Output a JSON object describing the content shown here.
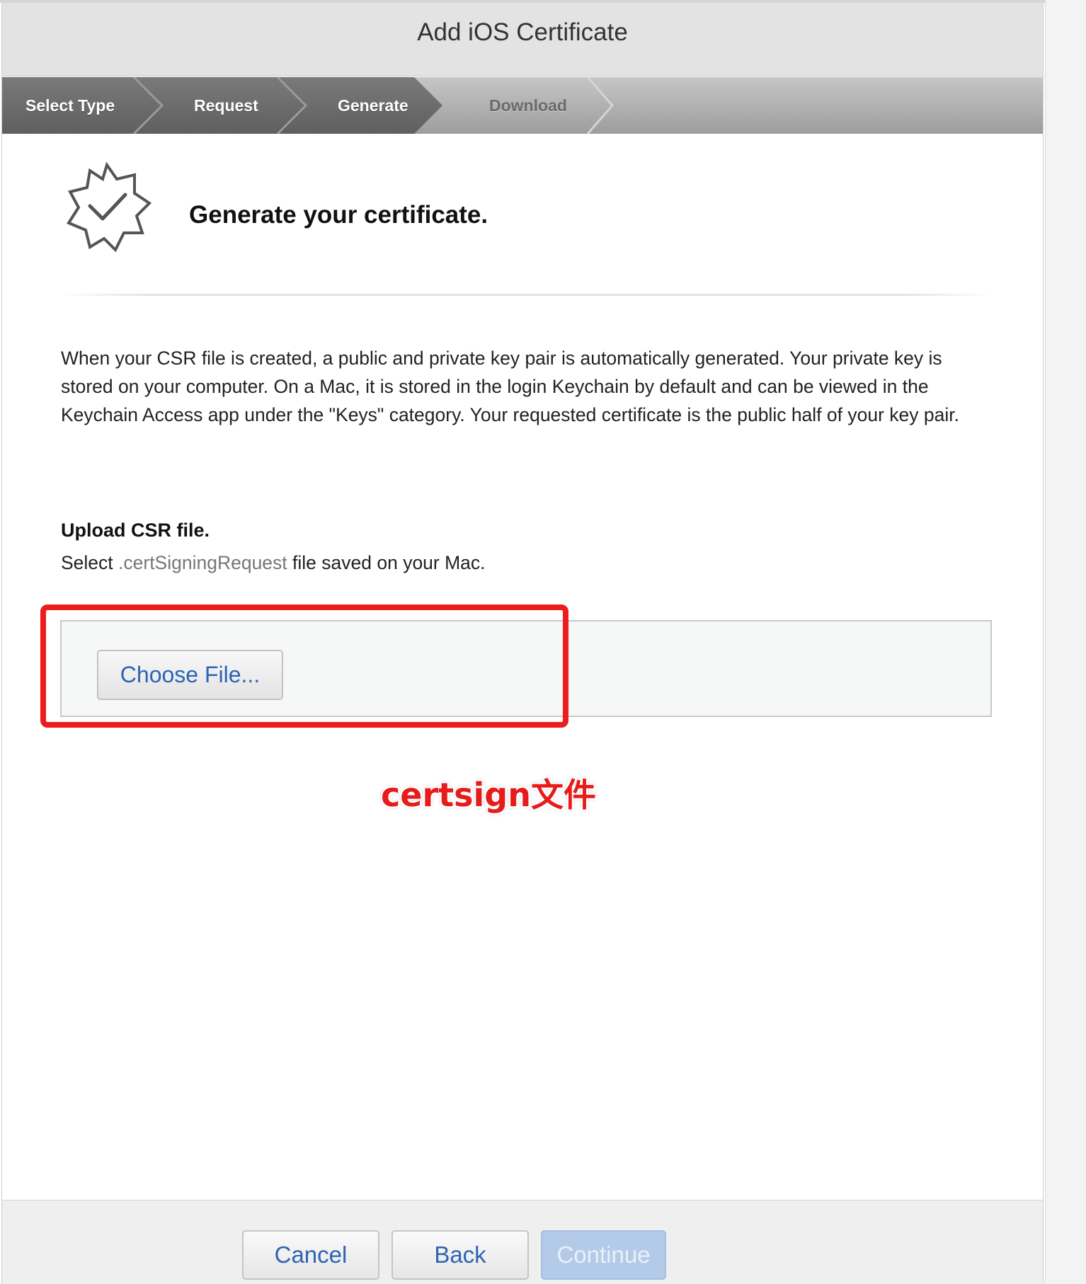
{
  "header": {
    "title": "Add iOS Certificate"
  },
  "steps": [
    {
      "label": "Select Type",
      "state": "done"
    },
    {
      "label": "Request",
      "state": "done"
    },
    {
      "label": "Generate",
      "state": "current"
    },
    {
      "label": "Download",
      "state": "pending"
    }
  ],
  "section": {
    "icon": "certificate-badge-check-icon",
    "title": "Generate your certificate."
  },
  "description": "When your CSR file is created, a public and private key pair is automatically generated. Your private key is stored on your computer. On a Mac, it is stored in the login Keychain by default and can be viewed in the Keychain Access app under the \"Keys\" category. Your requested certificate is the public half of your key pair.",
  "upload": {
    "heading": "Upload CSR file.",
    "sub_prefix": "Select ",
    "sub_ext": ".certSigningRequest",
    "sub_suffix": " file saved on your Mac.",
    "choose_label": "Choose File..."
  },
  "annotation": {
    "text": "certsign文件",
    "color": "#e81b1b"
  },
  "footer": {
    "cancel_label": "Cancel",
    "back_label": "Back",
    "continue_label": "Continue"
  },
  "colors": {
    "link_blue": "#2d64b3",
    "highlight_red": "#ee1c1c",
    "disabled_button": "#b3cbe8"
  }
}
